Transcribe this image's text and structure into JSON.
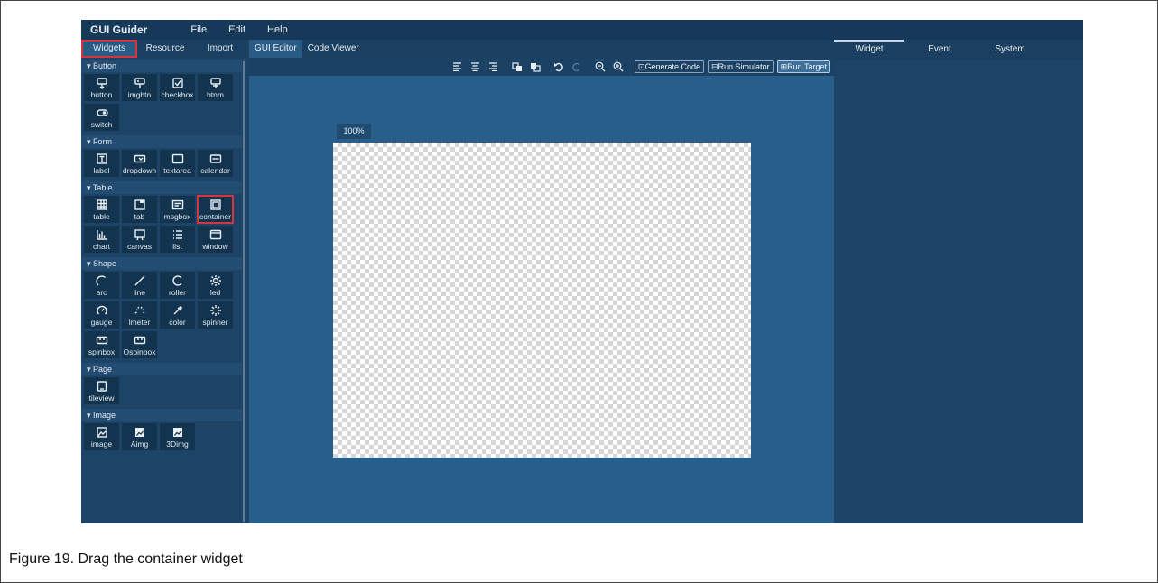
{
  "menubar": {
    "app_title": "GUI Guider",
    "menus": [
      "File",
      "Edit",
      "Help"
    ]
  },
  "left_tabs": [
    "Widgets",
    "Resource",
    "Import"
  ],
  "sections": [
    {
      "title": "▾ Button",
      "items": [
        {
          "label": "button",
          "icon": "button-icon"
        },
        {
          "label": "imgbtn",
          "icon": "imgbtn-icon"
        },
        {
          "label": "checkbox",
          "icon": "checkbox-icon"
        },
        {
          "label": "btnm",
          "icon": "btnm-icon"
        },
        {
          "label": "switch",
          "icon": "switch-icon"
        }
      ]
    },
    {
      "title": "▾ Form",
      "items": [
        {
          "label": "label",
          "icon": "label-icon"
        },
        {
          "label": "dropdown",
          "icon": "dropdown-icon"
        },
        {
          "label": "textarea",
          "icon": "textarea-icon"
        },
        {
          "label": "calendar",
          "icon": "calendar-icon"
        }
      ]
    },
    {
      "title": "▾ Table",
      "items": [
        {
          "label": "table",
          "icon": "table-icon"
        },
        {
          "label": "tab",
          "icon": "tab-icon"
        },
        {
          "label": "msgbox",
          "icon": "msgbox-icon"
        },
        {
          "label": "container",
          "icon": "container-icon",
          "highlighted": true
        },
        {
          "label": "chart",
          "icon": "chart-icon"
        },
        {
          "label": "canvas",
          "icon": "canvas-icon"
        },
        {
          "label": "list",
          "icon": "list-icon"
        },
        {
          "label": "window",
          "icon": "window-icon"
        }
      ]
    },
    {
      "title": "▾ Shape",
      "items": [
        {
          "label": "arc",
          "icon": "arc-icon"
        },
        {
          "label": "line",
          "icon": "line-icon"
        },
        {
          "label": "roller",
          "icon": "roller-icon"
        },
        {
          "label": "led",
          "icon": "led-icon"
        },
        {
          "label": "gauge",
          "icon": "gauge-icon"
        },
        {
          "label": "lmeter",
          "icon": "lmeter-icon"
        },
        {
          "label": "color",
          "icon": "color-icon"
        },
        {
          "label": "spinner",
          "icon": "spinner-icon"
        },
        {
          "label": "spinbox",
          "icon": "spinbox-icon"
        },
        {
          "label": "Ospinbox",
          "icon": "ospinbox-icon"
        }
      ]
    },
    {
      "title": "▾ Page",
      "items": [
        {
          "label": "tileview",
          "icon": "tileview-icon"
        }
      ]
    },
    {
      "title": "▾ Image",
      "items": [
        {
          "label": "image",
          "icon": "image-icon"
        },
        {
          "label": "Aimg",
          "icon": "aimg-icon"
        },
        {
          "label": "3Dimg",
          "icon": "3dimg-icon"
        }
      ]
    }
  ],
  "center_tabs": [
    "GUI Editor",
    "Code Viewer"
  ],
  "toolbar": {
    "generate": "Generate Code",
    "simulator": "Run Simulator",
    "target": "Run Target"
  },
  "zoom": "100%",
  "right_tabs": [
    "Widget",
    "Event",
    "System"
  ],
  "caption": "Figure 19.  Drag the container widget",
  "colors": {
    "highlight": "#d9343a",
    "panel": "#1d4466",
    "canvas_area": "#285f8a"
  }
}
